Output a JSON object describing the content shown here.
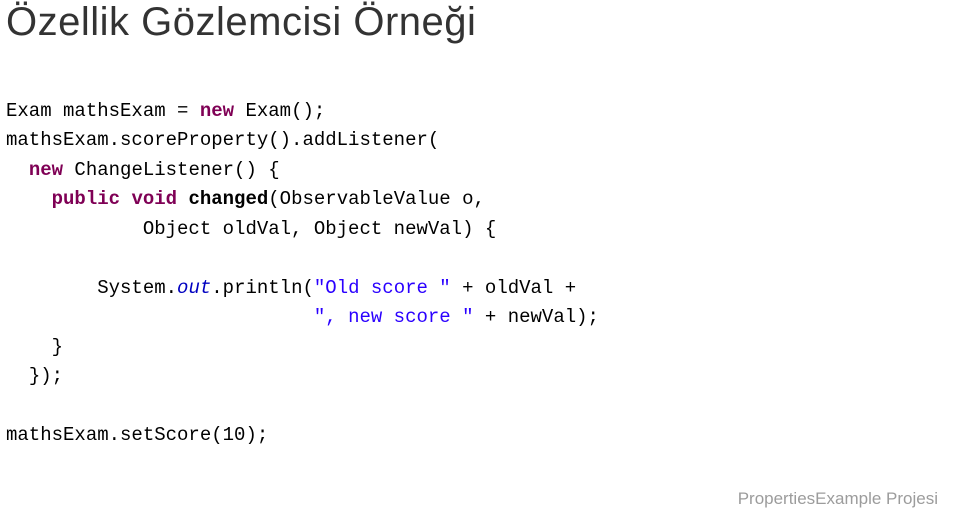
{
  "title": "Özellik Gözlemcisi Örneği",
  "code": {
    "line1": {
      "t1": "Exam mathsExam = ",
      "kw1": "new",
      "t2": " Exam();"
    },
    "line2": {
      "t1": "mathsExam.scoreProperty().addListener(",
      "t2": ""
    },
    "line3": {
      "indent": "  ",
      "kw1": "new",
      "t1": " ChangeListener() {"
    },
    "line4": {
      "indent": "    ",
      "kw1": "public",
      "t1": " ",
      "kw2": "void",
      "t2": " ",
      "mth": "changed",
      "t3": "(ObservableValue o,"
    },
    "line5": {
      "indent": "            ",
      "t1": "Object oldVal, Object newVal) {"
    },
    "line_blank": " ",
    "line6": {
      "indent": "        ",
      "t1": "System.",
      "fld": "out",
      "t2": ".println(",
      "str1": "\"Old score \"",
      "t3": " + oldVal + "
    },
    "line7": {
      "indent": "        ",
      "indent2": "                   ",
      "str1": "\", new score \"",
      "t1": " + newVal);"
    },
    "line8": {
      "indent": "    ",
      "t1": "}"
    },
    "line9": {
      "indent": "  ",
      "t1": "});"
    },
    "line_blank2": " ",
    "line10": {
      "t1": "mathsExam.setScore(10);"
    }
  },
  "footer": "PropertiesExample Projesi"
}
